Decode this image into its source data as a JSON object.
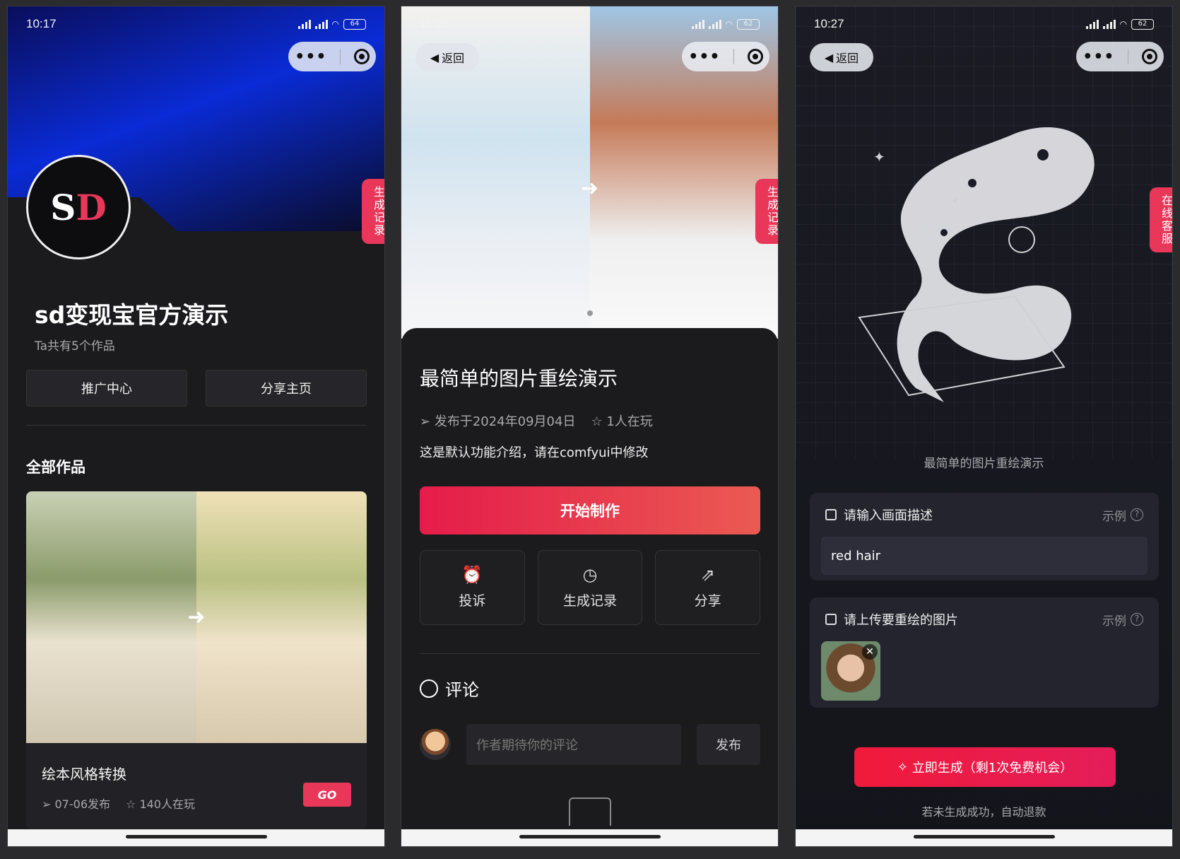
{
  "phones": {
    "p1": {
      "time": "10:17",
      "battery": "64",
      "profile_name": "sd变现宝官方演示",
      "works_count": "Ta共有5个作品",
      "btn_promo": "推广中心",
      "btn_share": "分享主页",
      "section_title": "全部作品",
      "side_tab": "生成记录",
      "logo_s": "S",
      "logo_d": "D",
      "card": {
        "title": "绘本风格转换",
        "date": "07-06发布",
        "players": "140人在玩",
        "go": "GO"
      }
    },
    "p2": {
      "time": "10:26",
      "battery": "62",
      "back": "返回",
      "side_tab": "生成记录",
      "title": "最简单的图片重绘演示",
      "published": "发布于2024年09月04日",
      "players": "1人在玩",
      "description": "这是默认功能介绍，请在comfyui中修改",
      "start_button": "开始制作",
      "actions": [
        {
          "label": "投诉",
          "icon": "alarm-icon"
        },
        {
          "label": "生成记录",
          "icon": "clock-icon"
        },
        {
          "label": "分享",
          "icon": "share-icon"
        }
      ],
      "comments_title": "评论",
      "comment_placeholder": "作者期待你的评论",
      "comment_send": "发布"
    },
    "p3": {
      "time": "10:27",
      "battery": "62",
      "back": "返回",
      "side_tab": "在线客服",
      "caption": "最简单的图片重绘演示",
      "prompt_label": "请输入画面描述",
      "example": "示例",
      "prompt_value": "red hair",
      "upload_label": "请上传要重绘的图片",
      "generate_button": "立即生成（剩1次免费机会）",
      "refund_note": "若未生成成功，自动退款"
    }
  },
  "colors": {
    "accent": "#e9375a",
    "background": "#1b1b1d",
    "panel": "#23242e"
  }
}
